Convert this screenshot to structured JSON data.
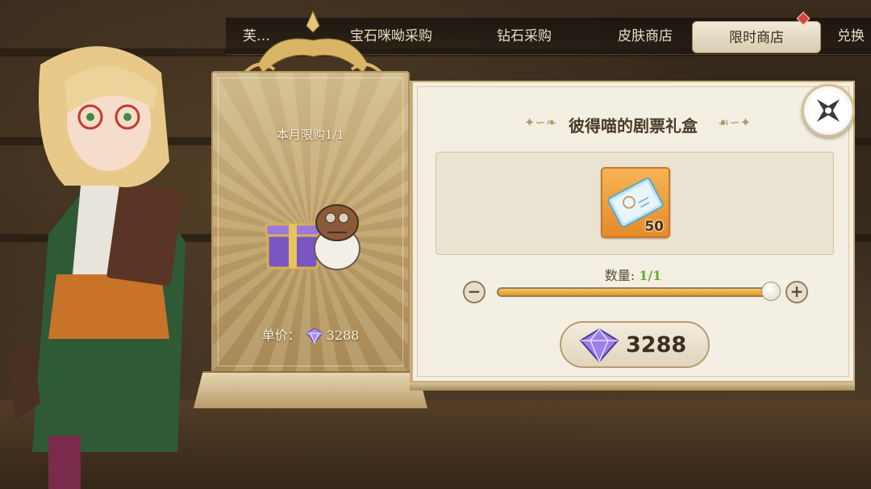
{
  "tabs": [
    {
      "label": "芙…",
      "active": false
    },
    {
      "label": "宝石咪呦采购",
      "active": false
    },
    {
      "label": "钻石采购",
      "active": false
    },
    {
      "label": "皮肤商店",
      "active": false
    },
    {
      "label": "限时商店",
      "active": true
    },
    {
      "label": "兑换",
      "active": false
    }
  ],
  "offer": {
    "limit_text": "本月限购1/1",
    "unit_price_label": "单价：",
    "unit_price_value": "3288",
    "currency_icon": "diamond-icon"
  },
  "detail": {
    "title": "彼得喵的剧票礼盒",
    "item_icon": "ticket-icon",
    "item_count": "50",
    "quantity_label": "数量: ",
    "quantity_value": "1/1",
    "quantity_fraction": 1.0,
    "buy_price": "3288"
  },
  "colors": {
    "panel_bg": "#f4efe3",
    "gold_border": "#c9ad78",
    "slider_fill": "#e29a22",
    "quantity_green": "#6aa83a",
    "notification_red": "#d8443a"
  }
}
